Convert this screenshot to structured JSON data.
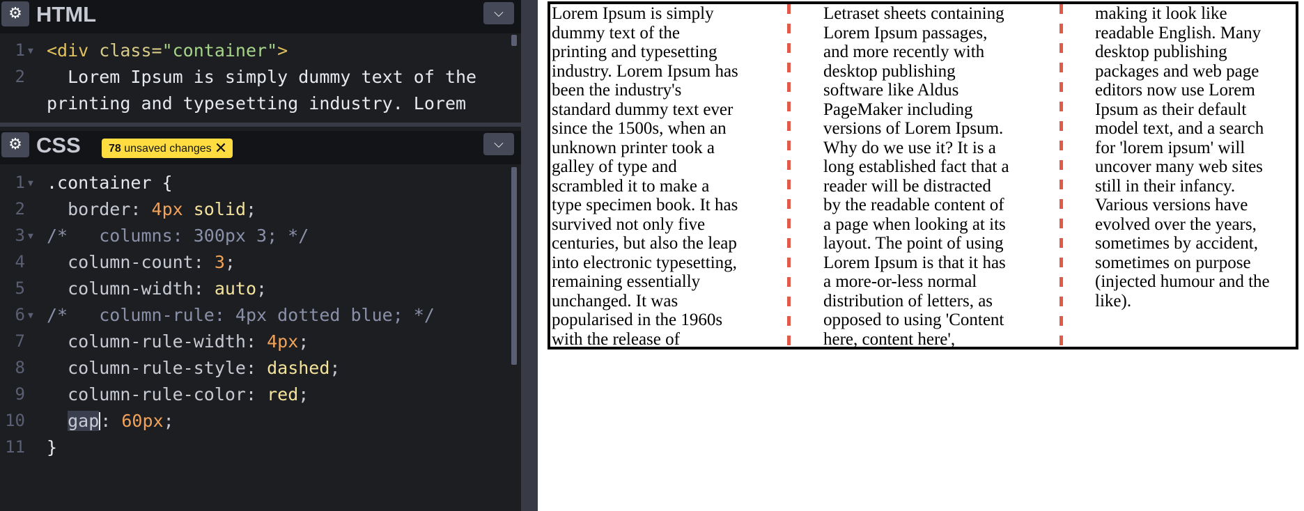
{
  "html_panel": {
    "title": "HTML",
    "lines": [
      {
        "num": "1",
        "tag_open": "<div",
        "attr": " class=",
        "value": "\"container\"",
        "tag_close": ">"
      },
      {
        "num": "2",
        "text1": "  Lorem Ipsum is simply dummy text of the",
        "text2": "printing and typesetting industry. Lorem"
      }
    ]
  },
  "css_panel": {
    "title": "CSS",
    "badge": {
      "count": "78",
      "text": "unsaved changes"
    },
    "lines": [
      {
        "num": "1"
      },
      {
        "num": "2"
      },
      {
        "num": "3"
      },
      {
        "num": "4"
      },
      {
        "num": "5"
      },
      {
        "num": "6"
      },
      {
        "num": "7"
      },
      {
        "num": "8"
      },
      {
        "num": "9"
      },
      {
        "num": "10"
      },
      {
        "num": "11"
      }
    ],
    "code": {
      "l1_sel": ".container",
      "l1_brace": " {",
      "l2_prop": "  border",
      "l2_num": "4px",
      "l2_kw": "solid",
      "l3_comment": "/*   columns: 300px 3; */",
      "l4_prop": "  column-count",
      "l4_num": "3",
      "l5_prop": "  column-width",
      "l5_kw": "auto",
      "l6_comment": "/*   column-rule: 4px dotted blue; */",
      "l7_prop": "  column-rule-width",
      "l7_num": "4px",
      "l8_prop": "  column-rule-style",
      "l8_kw": "dashed",
      "l9_prop": "  column-rule-color",
      "l9_kw": "red",
      "l10_prop": "gap",
      "l10_num": "60px",
      "l11": "}"
    }
  },
  "preview": {
    "col1": [
      "Lorem Ipsum is simply",
      "dummy text of the",
      "printing and typesetting",
      "industry. Lorem Ipsum has",
      "been the industry's",
      "standard dummy text ever",
      "since the 1500s, when an",
      "unknown printer took a",
      "galley of type and",
      "scrambled it to make a",
      "type specimen book. It has",
      "survived not only five",
      "centuries, but also the leap",
      "into electronic typesetting,",
      "remaining essentially",
      "unchanged. It was",
      "popularised in the 1960s",
      "with the release of"
    ],
    "col2": [
      "Letraset sheets containing",
      "Lorem Ipsum passages,",
      "and more recently with",
      "desktop publishing",
      "software like Aldus",
      "PageMaker including",
      "versions of Lorem Ipsum.",
      "Why do we use it? It is a",
      "long established fact that a",
      "reader will be distracted",
      "by the readable content of",
      "a page when looking at its",
      "layout. The point of using",
      "Lorem Ipsum is that it has",
      "a more-or-less normal",
      "distribution of letters, as",
      "opposed to using 'Content",
      "here, content here',"
    ],
    "col3": [
      "making it look like",
      "readable English. Many",
      "desktop publishing",
      "packages and web page",
      "editors now use Lorem",
      "Ipsum as their default",
      "model text, and a search",
      "for 'lorem ipsum' will",
      "uncover many web sites",
      "still in their infancy.",
      "Various versions have",
      "evolved over the years,",
      "sometimes by accident,",
      "sometimes on purpose",
      "(injected humour and the",
      "like)."
    ]
  },
  "icons": {
    "settings": "⚙",
    "collapse": "⌄",
    "close": "✕"
  }
}
